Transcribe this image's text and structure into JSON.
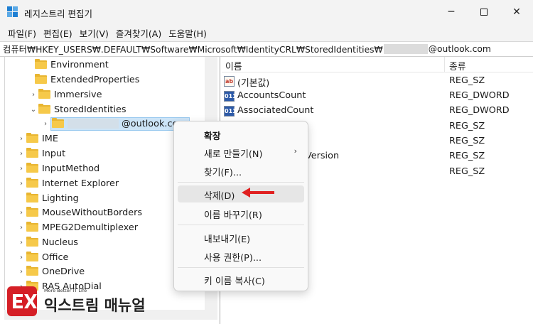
{
  "window": {
    "title": "레지스트리 편집기",
    "minimize_icon": "minimize-icon",
    "maximize_icon": "maximize-icon",
    "close_icon": "close-icon"
  },
  "menubar": [
    "파일(F)",
    "편집(E)",
    "보기(V)",
    "즐겨찾기(A)",
    "도움말(H)"
  ],
  "address": {
    "prefix": "컴퓨터₩HKEY_USERS₩.DEFAULT₩Software₩Microsoft₩IdentityCRL₩StoredIdentities₩",
    "suffix": "@outlook.com"
  },
  "tree": {
    "items": [
      {
        "label": "Environment",
        "chevron": ""
      },
      {
        "label": "ExtendedProperties",
        "chevron": ""
      },
      {
        "label": "Immersive",
        "chevron": "›"
      },
      {
        "label": "StoredIdentities",
        "chevron": "⌄"
      },
      {
        "label": "@outlook.com",
        "chevron": "›"
      },
      {
        "label": "IME",
        "chevron": "›"
      },
      {
        "label": "Input",
        "chevron": "›"
      },
      {
        "label": "InputMethod",
        "chevron": "›"
      },
      {
        "label": "Internet Explorer",
        "chevron": "›"
      },
      {
        "label": "Lighting",
        "chevron": ""
      },
      {
        "label": "MouseWithoutBorders",
        "chevron": "›"
      },
      {
        "label": "MPEG2Demultiplexer",
        "chevron": "›"
      },
      {
        "label": "Nucleus",
        "chevron": "›"
      },
      {
        "label": "Office",
        "chevron": "›"
      },
      {
        "label": "OneDrive",
        "chevron": "›"
      },
      {
        "label": "RAS AutoDial",
        "chevron": "›"
      }
    ]
  },
  "values": {
    "header_name": "이름",
    "header_type": "종류",
    "rows": [
      {
        "name": "(기본값)",
        "type": "REG_SZ",
        "icon": "ab"
      },
      {
        "name": "AccountsCount",
        "type": "REG_DWORD",
        "icon": "011"
      },
      {
        "name": "AssociatedCount",
        "type": "REG_DWORD",
        "icon": "011"
      },
      {
        "name": "",
        "type": "REG_SZ",
        "icon": ""
      },
      {
        "name": "",
        "type": "REG_SZ",
        "icon": ""
      },
      {
        "name": "Version",
        "type": "REG_SZ",
        "icon": ""
      },
      {
        "name": "",
        "type": "REG_SZ",
        "icon": ""
      }
    ]
  },
  "context_menu": {
    "expand": "확장",
    "new": "새로 만들기(N)",
    "find": "찾기(F)...",
    "delete": "삭제(D)",
    "rename": "이름 바꾸기(R)",
    "export": "내보내기(E)",
    "permissions": "사용 권한(P)...",
    "copy_key_name": "키 이름 복사(C)"
  },
  "logo": {
    "tagline": "More Better IT Life",
    "name": "익스트림 매뉴얼"
  },
  "colors": {
    "accent_arrow": "#e02020",
    "selection": "#cce4f7",
    "logo_red": "#d51f26"
  }
}
